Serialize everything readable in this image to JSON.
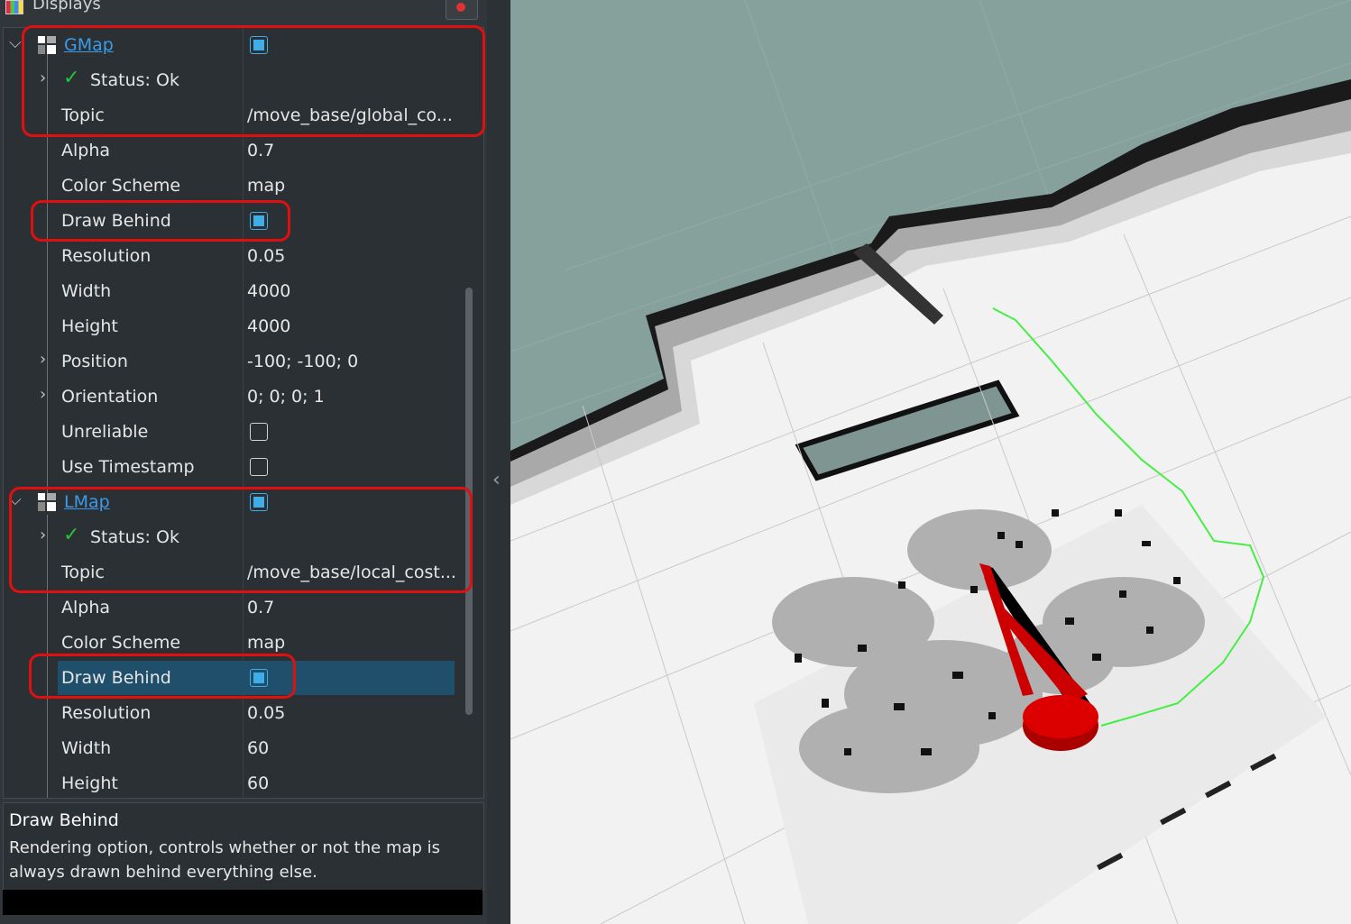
{
  "panel": {
    "title": "Displays",
    "close_icon": "close-icon"
  },
  "gmap": {
    "name": "GMap",
    "enabled": true,
    "status": "Status: Ok",
    "topic_label": "Topic",
    "topic_value": "/move_base/global_co...",
    "alpha_label": "Alpha",
    "alpha_value": "0.7",
    "color_scheme_label": "Color Scheme",
    "color_scheme_value": "map",
    "draw_behind_label": "Draw Behind",
    "draw_behind": true,
    "resolution_label": "Resolution",
    "resolution_value": "0.05",
    "width_label": "Width",
    "width_value": "4000",
    "height_label": "Height",
    "height_value": "4000",
    "position_label": "Position",
    "position_value": "-100; -100; 0",
    "orientation_label": "Orientation",
    "orientation_value": "0; 0; 0; 1",
    "unreliable_label": "Unreliable",
    "unreliable": false,
    "use_timestamp_label": "Use Timestamp",
    "use_timestamp": false
  },
  "lmap": {
    "name": "LMap",
    "enabled": true,
    "status": "Status: Ok",
    "topic_label": "Topic",
    "topic_value": "/move_base/local_cost...",
    "alpha_label": "Alpha",
    "alpha_value": "0.7",
    "color_scheme_label": "Color Scheme",
    "color_scheme_value": "map",
    "draw_behind_label": "Draw Behind",
    "draw_behind": true,
    "resolution_label": "Resolution",
    "resolution_value": "0.05",
    "width_label": "Width",
    "width_value": "60",
    "height_label": "Height",
    "height_value": "60"
  },
  "description": {
    "title": "Draw Behind",
    "body": "Rendering option, controls whether or not the map is always drawn behind everything else."
  },
  "colors": {
    "highlight": "#e01010",
    "link_blue": "#3d9ae8",
    "status_green": "#27c23a",
    "checkbox_blue": "#3daee9",
    "path_green": "#44ee44",
    "robot_red": "#cc0000"
  }
}
